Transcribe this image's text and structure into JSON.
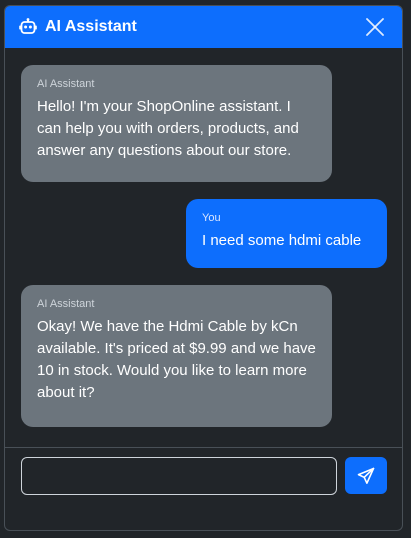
{
  "header": {
    "title": "AI Assistant",
    "icon": "robot-icon",
    "close_icon": "close-icon",
    "background_color": "#0d6efd"
  },
  "messages": [
    {
      "role": "assistant",
      "sender": "AI Assistant",
      "text": "Hello! I'm your ShopOnline assistant. I can help you with orders, products, and answer any questions about our store."
    },
    {
      "role": "user",
      "sender": "You",
      "text": "I need some hdmi cable"
    },
    {
      "role": "assistant",
      "sender": "AI Assistant",
      "text": "Okay! We have the Hdmi Cable by kCn available. It's priced at $9.99 and we have 10 in stock. Would you like to learn more about it?"
    }
  ],
  "composer": {
    "value": "",
    "placeholder": "",
    "send_icon": "send-icon"
  }
}
